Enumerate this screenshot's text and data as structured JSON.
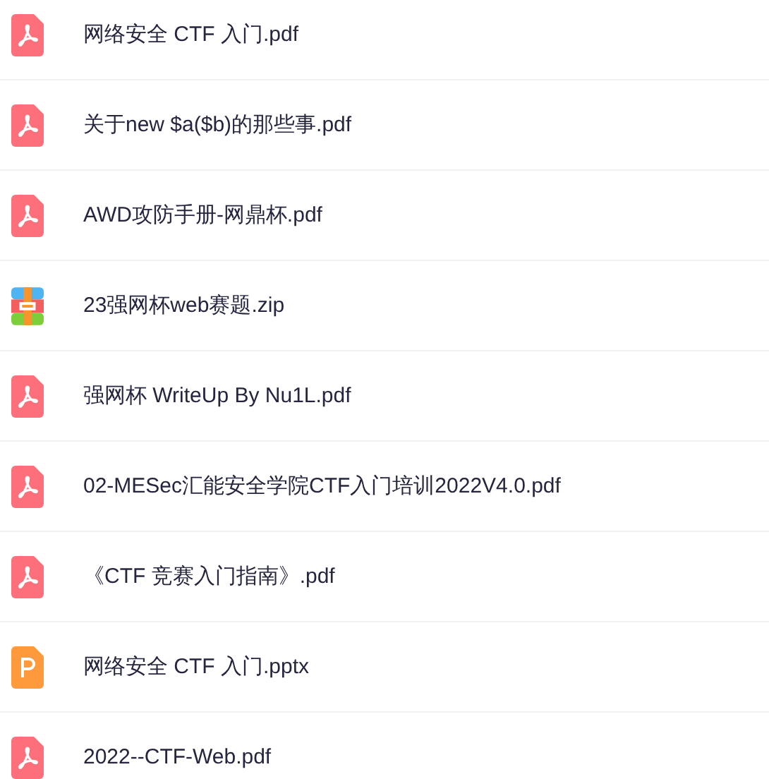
{
  "files": [
    {
      "kind": "pdf",
      "name": "网络安全 CTF 入门.pdf"
    },
    {
      "kind": "pdf",
      "name": "关于new $a($b)的那些事.pdf"
    },
    {
      "kind": "pdf",
      "name": "AWD攻防手册-网鼎杯.pdf"
    },
    {
      "kind": "zip",
      "name": "23强网杯web赛题.zip"
    },
    {
      "kind": "pdf",
      "name": "强网杯 WriteUp By Nu1L.pdf"
    },
    {
      "kind": "pdf",
      "name": "02-MESec汇能安全学院CTF入门培训2022V4.0.pdf"
    },
    {
      "kind": "pdf",
      "name": "《CTF 竞赛入门指南》.pdf"
    },
    {
      "kind": "ppt",
      "name": "网络安全 CTF 入门.pptx"
    },
    {
      "kind": "pdf",
      "name": "2022--CTF-Web.pdf"
    }
  ]
}
